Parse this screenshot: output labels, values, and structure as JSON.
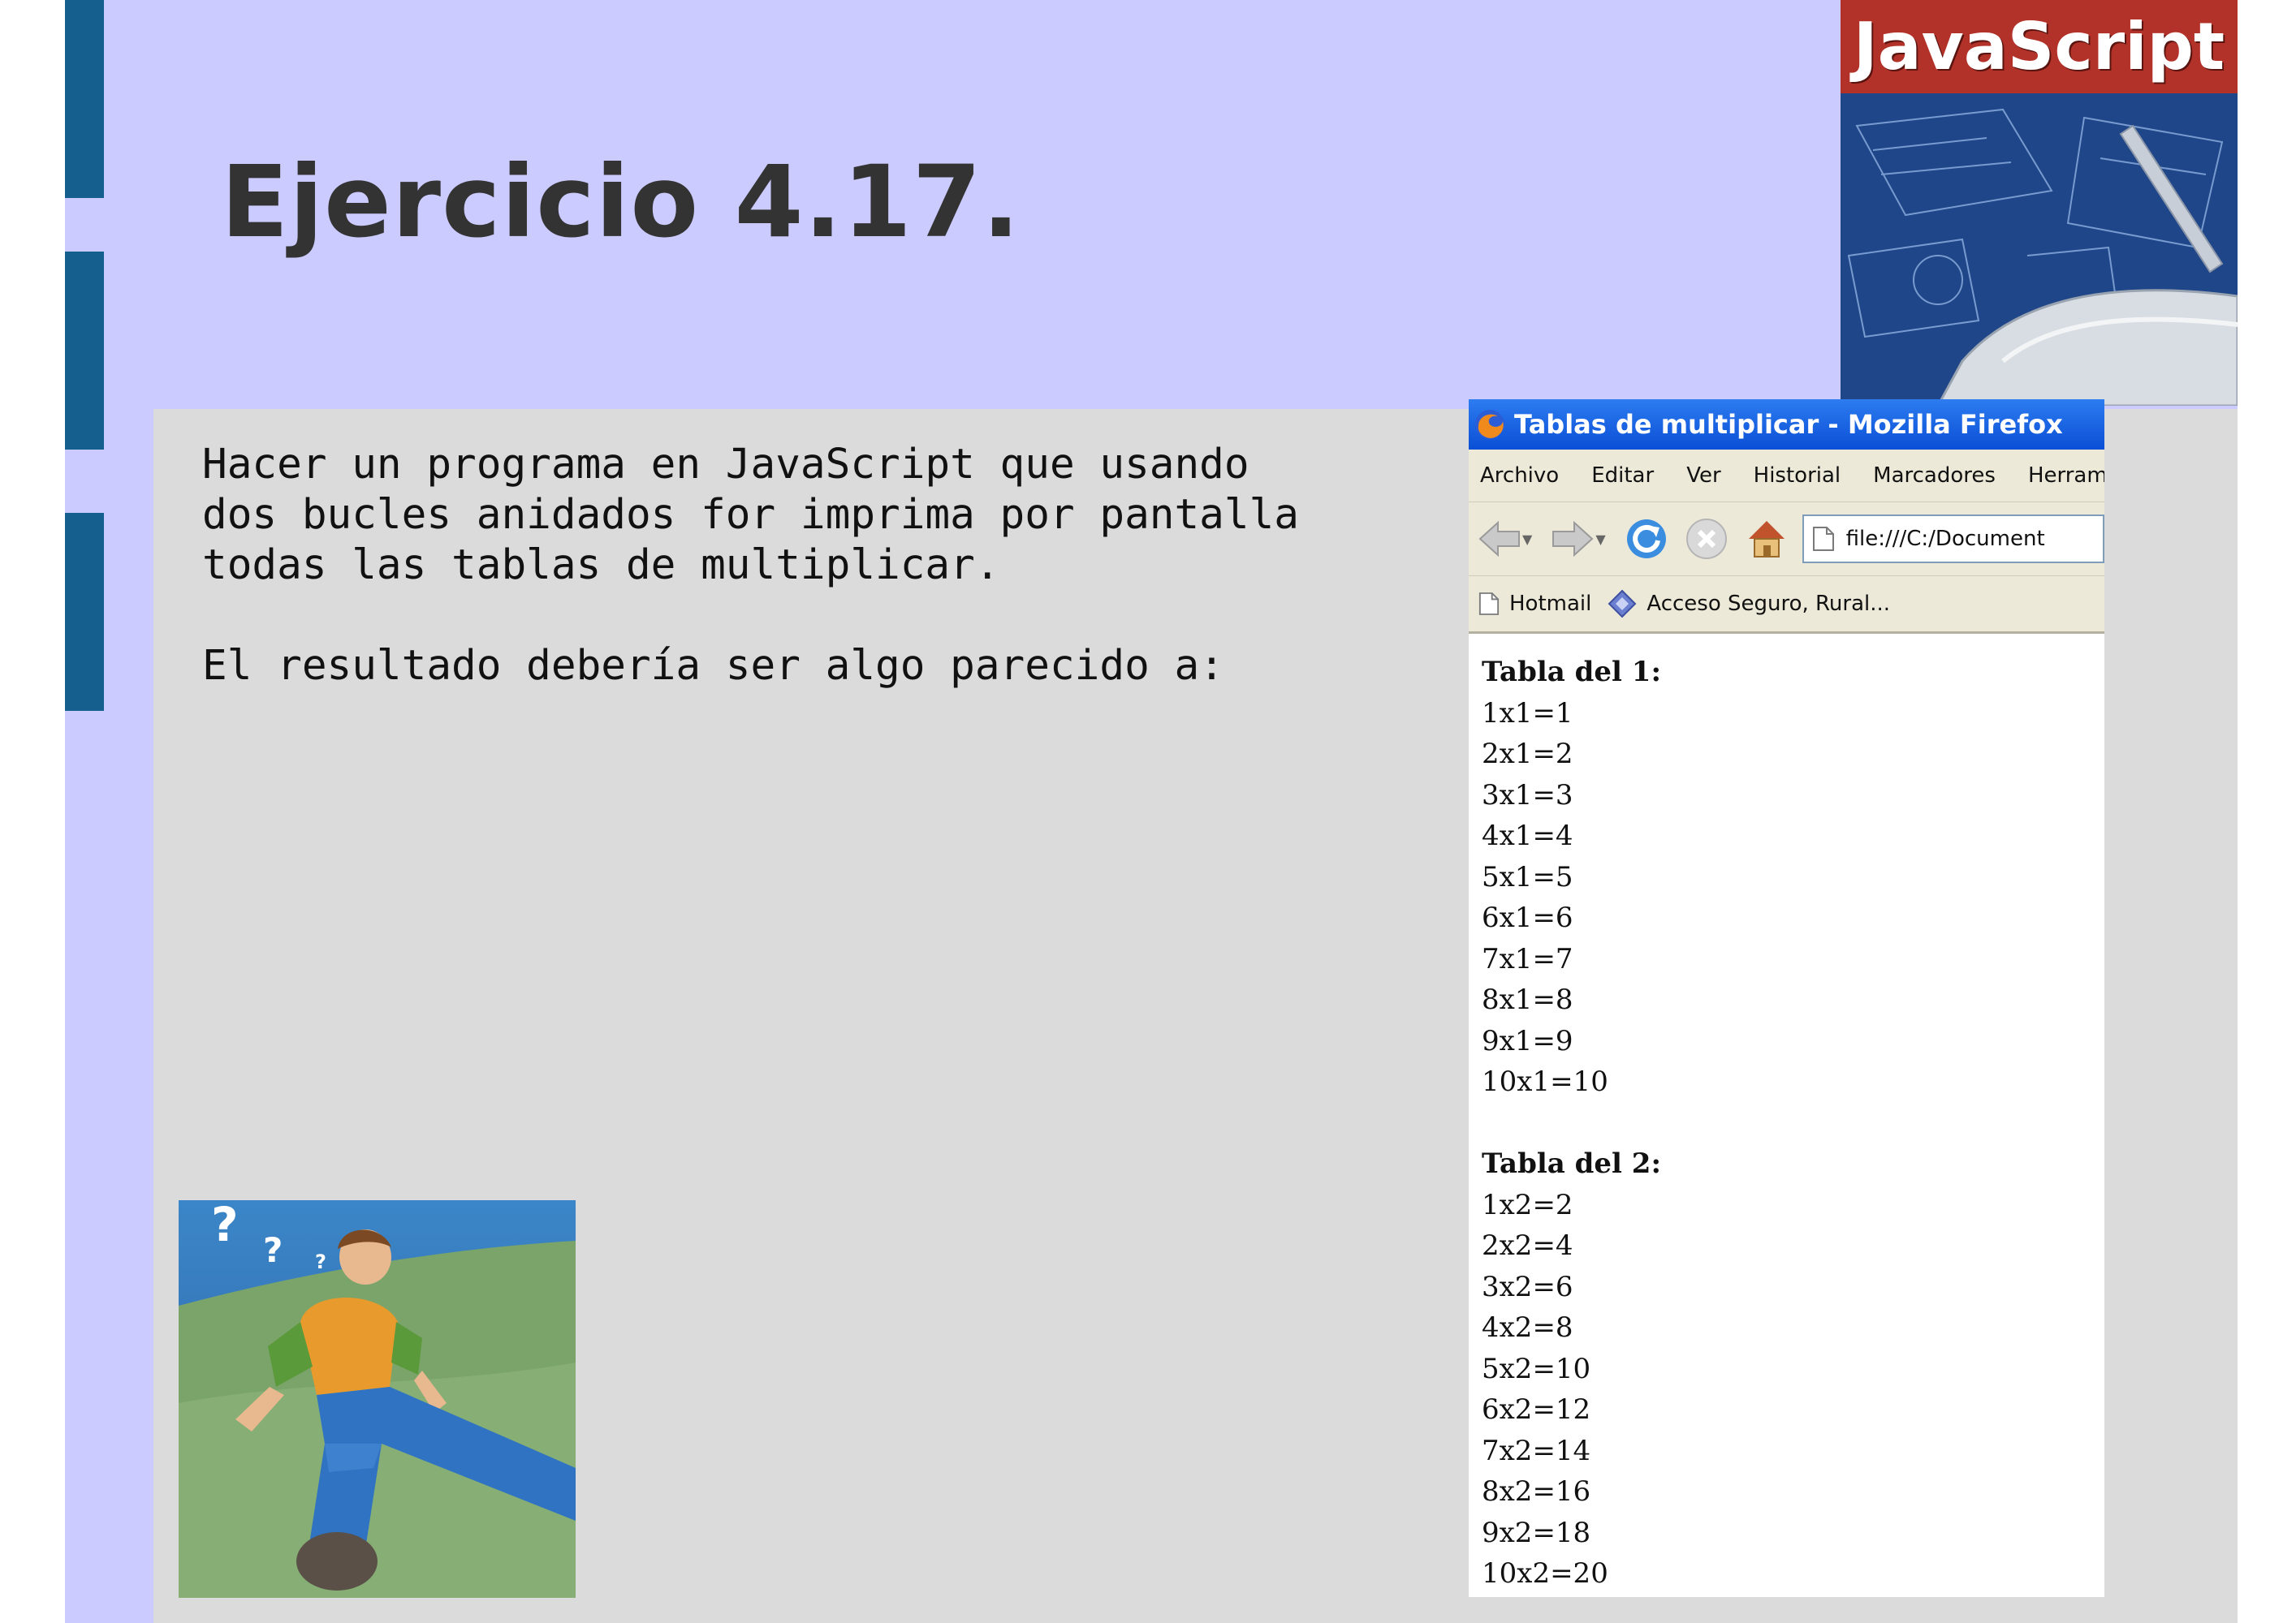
{
  "slide": {
    "title": "Ejercicio 4.17.",
    "body_paragraphs": [
      "Hacer un programa en JavaScript que usando",
      "dos bucles anidados for imprima por pantalla",
      "todas las tablas de multiplicar.",
      "",
      "El resultado debería ser algo parecido a:"
    ],
    "logo_text": "JavaScript",
    "colors": {
      "background": "#cbcbff",
      "panel": "#dbdbdb",
      "accent": "#155f8f",
      "title": "#333333"
    }
  },
  "browser": {
    "window_title": "Tablas de multiplicar - Mozilla Firefox",
    "menu": [
      "Archivo",
      "Editar",
      "Ver",
      "Historial",
      "Marcadores",
      "Herramient"
    ],
    "url": "file:///C:/Document",
    "bookmarks": [
      "Hotmail",
      "Acceso Seguro, Rural..."
    ],
    "icons": [
      "firefox-icon",
      "back-arrow-icon",
      "forward-arrow-icon",
      "reload-icon",
      "stop-icon",
      "home-icon",
      "page-icon",
      "bookmark-diamond-icon"
    ],
    "tables": [
      {
        "heading": "Tabla del 1:",
        "rows": [
          "1x1=1",
          "2x1=2",
          "3x1=3",
          "4x1=4",
          "5x1=5",
          "6x1=6",
          "7x1=7",
          "8x1=8",
          "9x1=9",
          "10x1=10"
        ]
      },
      {
        "heading": "Tabla del 2:",
        "rows": [
          "1x2=2",
          "2x2=4",
          "3x2=6",
          "4x2=8",
          "5x2=10",
          "6x2=12",
          "7x2=14",
          "8x2=16",
          "9x2=18",
          "10x2=20"
        ]
      }
    ]
  }
}
